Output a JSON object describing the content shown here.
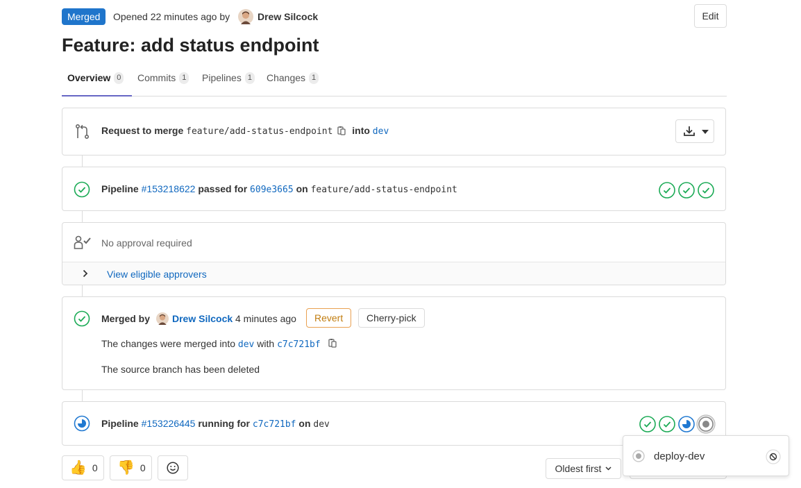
{
  "header": {
    "status_badge": "Merged",
    "opened_text": "Opened 22 minutes ago by",
    "author": "Drew Silcock",
    "edit_label": "Edit",
    "title": "Feature: add status endpoint"
  },
  "tabs": [
    {
      "label": "Overview",
      "count": "0"
    },
    {
      "label": "Commits",
      "count": "1"
    },
    {
      "label": "Pipelines",
      "count": "1"
    },
    {
      "label": "Changes",
      "count": "1"
    }
  ],
  "merge_request": {
    "prefix": "Request to merge",
    "source_branch": "feature/add-status-endpoint",
    "into": "into",
    "target_branch": "dev"
  },
  "pipeline1": {
    "label": "Pipeline",
    "id": "#153218622",
    "status_text": "passed for",
    "commit": "609e3665",
    "on": "on",
    "branch": "feature/add-status-endpoint"
  },
  "approval": {
    "text": "No approval required",
    "view_approvers": "View eligible approvers"
  },
  "merged": {
    "merged_by": "Merged by",
    "author": "Drew Silcock",
    "time": "4 minutes ago",
    "revert": "Revert",
    "cherry_pick": "Cherry-pick",
    "changes_prefix": "The changes were merged into",
    "branch": "dev",
    "with": "with",
    "commit": "c7c721bf",
    "source_deleted": "The source branch has been deleted"
  },
  "pipeline2": {
    "label": "Pipeline",
    "id": "#153226445",
    "status_text": "running for",
    "commit": "c7c721bf",
    "on": "on",
    "branch": "dev"
  },
  "awards": {
    "thumbs_up_count": "0",
    "thumbs_down_count": "0"
  },
  "sort": {
    "label": "Oldest first"
  },
  "jobs_dropdown": {
    "job_name": "deploy-dev"
  },
  "colors": {
    "success": "#1aaa55",
    "running": "#1f78d1",
    "link": "#1068bf",
    "merged_badge": "#1f75cb",
    "revert_border": "#e9a050"
  }
}
